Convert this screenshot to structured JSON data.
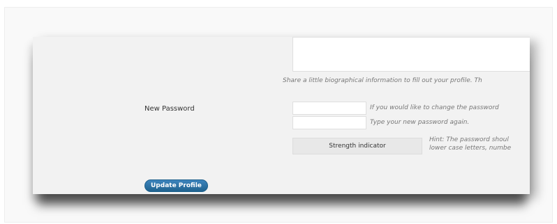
{
  "profile_form": {
    "bio": {
      "value": "",
      "description": "Share a little biographical information to fill out your profile. Th"
    },
    "new_password": {
      "label": "New Password",
      "field1_value": "",
      "field1_hint": "If you would like to change the password",
      "field2_value": "",
      "field2_hint": "Type your new password again.",
      "strength_indicator": "Strength indicator",
      "hint_line1": "Hint: The password shoul",
      "hint_line2": "lower case letters, numbe"
    },
    "update_button": "Update Profile"
  },
  "colors": {
    "button_blue": "#21759b",
    "card_background": "#f2f2f2"
  }
}
